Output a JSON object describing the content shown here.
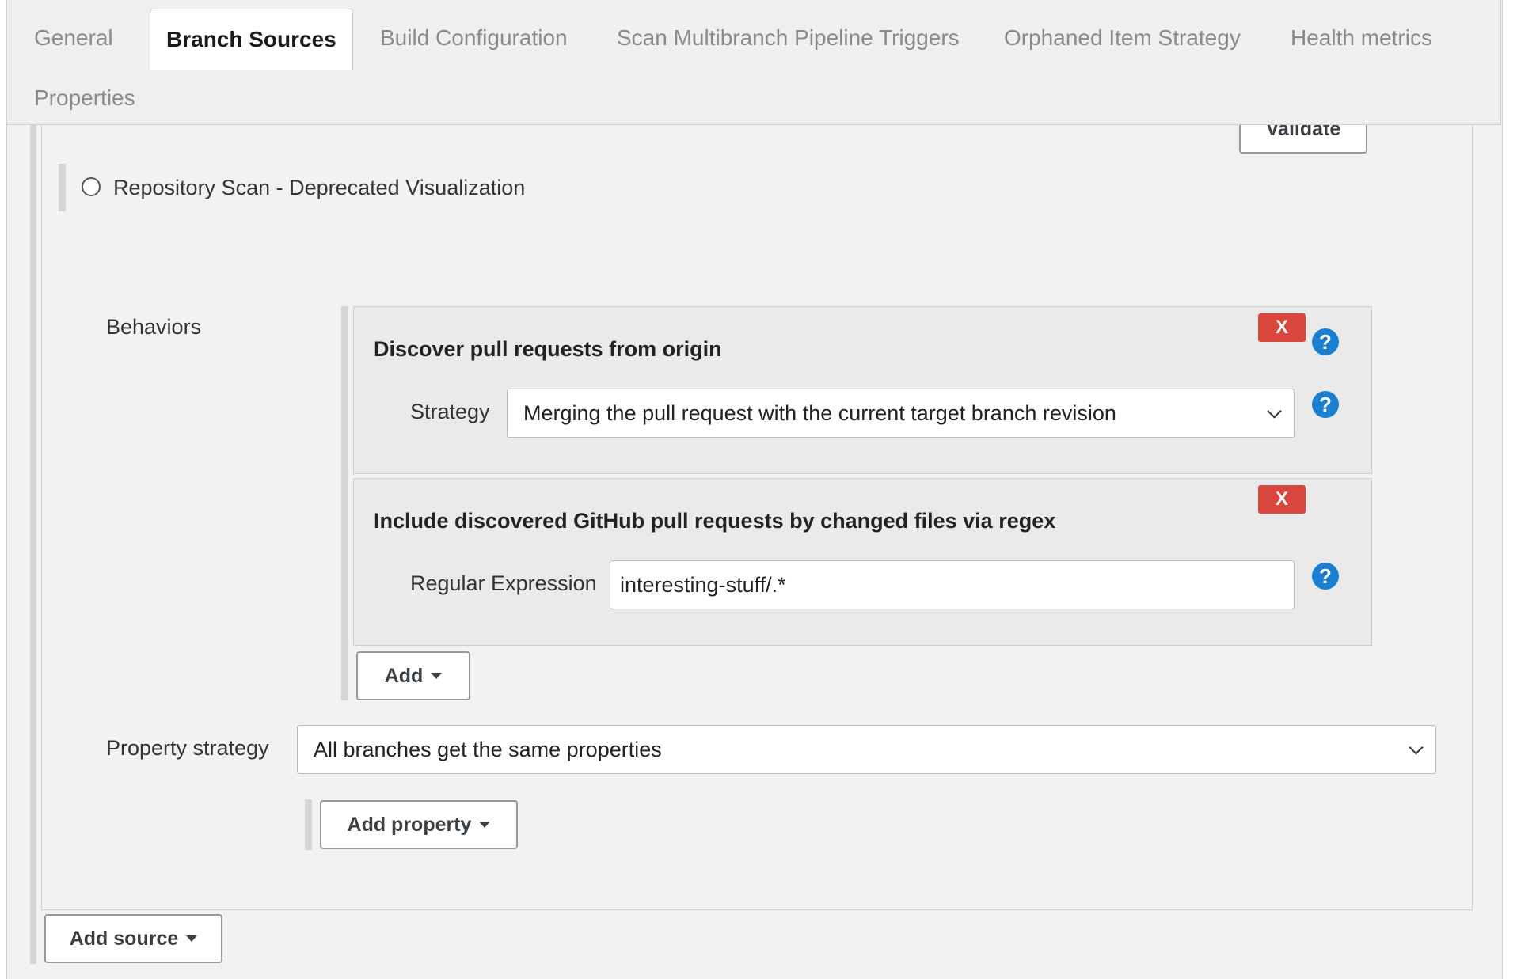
{
  "tabs": [
    {
      "label": "General",
      "active": false
    },
    {
      "label": "Branch Sources",
      "active": true
    },
    {
      "label": "Build Configuration",
      "active": false
    },
    {
      "label": "Scan Multibranch Pipeline Triggers",
      "active": false
    },
    {
      "label": "Orphaned Item Strategy",
      "active": false
    },
    {
      "label": "Health metrics",
      "active": false
    },
    {
      "label": "Properties",
      "active": false
    }
  ],
  "validate_label": "Validate",
  "repo_scan_label": "Repository Scan - Deprecated Visualization",
  "behaviors": {
    "label": "Behaviors",
    "items": [
      {
        "title": "Discover pull requests from origin",
        "remove_label": "X",
        "field_label": "Strategy",
        "field_value": "Merging the pull request with the current target branch revision"
      },
      {
        "title": "Include discovered GitHub pull requests by changed files via regex",
        "remove_label": "X",
        "field_label": "Regular Expression",
        "field_value": "interesting-stuff/.*"
      }
    ],
    "add_label": "Add",
    "help_label": "?"
  },
  "property_strategy": {
    "label": "Property strategy",
    "value": "All branches get the same properties",
    "add_property_label": "Add property"
  },
  "add_source_label": "Add source",
  "colors": {
    "remove": "#d9463b",
    "help": "#1a7fd1",
    "panel": "#f2f2f2"
  }
}
